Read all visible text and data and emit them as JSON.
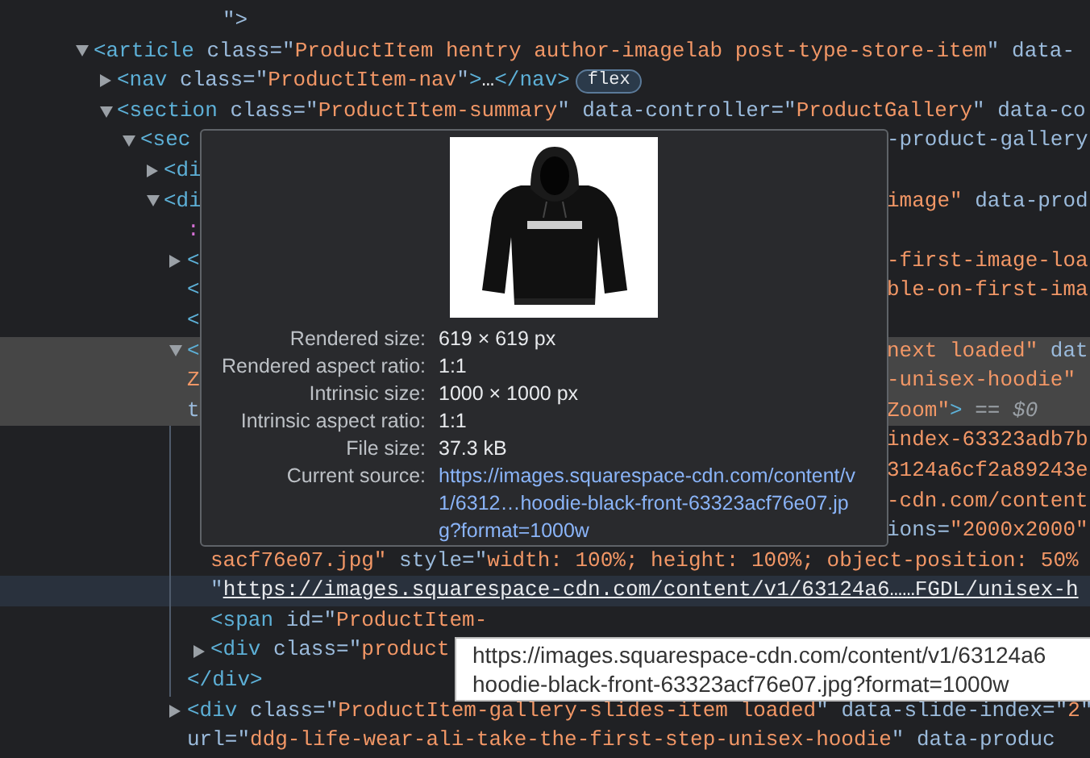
{
  "elements_tree": [
    {
      "kind": "tail",
      "selected": false,
      "left": [
        {
          "kind": "attr",
          "text": "\">"
        }
      ]
    },
    {
      "kind": "branch",
      "expanded": true,
      "selected": false,
      "left": [
        {
          "kind": "tag",
          "text": "<article"
        },
        {
          "kind": "attr",
          "text": " class=\""
        },
        {
          "kind": "val",
          "text": "ProductItem hentry author-imagelab post-type-store-item"
        },
        {
          "kind": "attr",
          "text": "\" data-"
        }
      ],
      "children": [
        {
          "kind": "branch",
          "expanded": false,
          "selected": false,
          "left": [
            {
              "kind": "tag",
              "text": "<nav"
            },
            {
              "kind": "attr",
              "text": " class=\""
            },
            {
              "kind": "val",
              "text": "ProductItem-nav"
            },
            {
              "kind": "attr",
              "text": "\""
            },
            {
              "kind": "tag",
              "text": ">"
            },
            {
              "kind": "text",
              "text": "…"
            },
            {
              "kind": "tag",
              "text": "</nav>"
            }
          ],
          "badge": "flex"
        },
        {
          "kind": "branch",
          "expanded": true,
          "selected": false,
          "left": [
            {
              "kind": "tag",
              "text": "<section"
            },
            {
              "kind": "attr",
              "text": " class=\""
            },
            {
              "kind": "val",
              "text": "ProductItem-summary"
            },
            {
              "kind": "attr",
              "text": "\" data-controller=\""
            },
            {
              "kind": "val",
              "text": "ProductGallery"
            },
            {
              "kind": "attr",
              "text": "\" data-co"
            }
          ],
          "children": [
            {
              "kind": "branch",
              "expanded": true,
              "selected": false,
              "left": [
                {
                  "kind": "tag",
                  "text": "<sec"
                }
              ],
              "right": [
                {
                  "kind": "attr",
                  "text": "-product-gallery"
                }
              ],
              "children": [
                {
                  "kind": "branch",
                  "expanded": false,
                  "selected": false,
                  "left": [
                    {
                      "kind": "tag",
                      "text": "<di"
                    }
                  ]
                },
                {
                  "kind": "branch",
                  "expanded": true,
                  "selected": false,
                  "left": [
                    {
                      "kind": "tag",
                      "text": "<di"
                    }
                  ],
                  "right": [
                    {
                      "kind": "val",
                      "text": "image\""
                    },
                    {
                      "kind": "attr",
                      "text": " data-prod"
                    }
                  ],
                  "children": [
                    {
                      "kind": "leaf",
                      "selected": false,
                      "left": [
                        {
                          "kind": "pseudo",
                          "text": ":"
                        }
                      ]
                    },
                    {
                      "kind": "branch",
                      "expanded": false,
                      "selected": false,
                      "left": [
                        {
                          "kind": "tag",
                          "text": "<"
                        }
                      ],
                      "right": [
                        {
                          "kind": "val",
                          "text": "-first-image-loa"
                        }
                      ]
                    },
                    {
                      "kind": "leaf",
                      "selected": false,
                      "left": [
                        {
                          "kind": "tag",
                          "text": "<"
                        }
                      ],
                      "right": [
                        {
                          "kind": "val",
                          "text": "ble-on-first-ima"
                        }
                      ]
                    },
                    {
                      "kind": "leaf",
                      "selected": false,
                      "left": [
                        {
                          "kind": "tag",
                          "text": "<"
                        }
                      ]
                    },
                    {
                      "kind": "branch",
                      "expanded": true,
                      "selected": true,
                      "left": [
                        {
                          "kind": "tag",
                          "text": "<"
                        }
                      ],
                      "right": [
                        {
                          "kind": "val",
                          "text": "next loaded\""
                        },
                        {
                          "kind": "attr",
                          "text": " dat"
                        }
                      ],
                      "wraps": [
                        {
                          "left": [
                            {
                              "kind": "val",
                              "text": "Z"
                            }
                          ],
                          "right": [
                            {
                              "kind": "val",
                              "text": "-unisex-hoodie\""
                            }
                          ]
                        },
                        {
                          "left": [
                            {
                              "kind": "attr",
                              "text": "t"
                            }
                          ],
                          "right": [
                            {
                              "kind": "val",
                              "text": "Zoom\""
                            },
                            {
                              "kind": "tag",
                              "text": ">"
                            },
                            {
                              "kind": "muted",
                              "text": " == $0"
                            }
                          ]
                        }
                      ],
                      "children": [
                        {
                          "kind": "leaf",
                          "selected": false,
                          "right": [
                            {
                              "kind": "val",
                              "text": "index-63323adb7b"
                            }
                          ],
                          "wraps": [
                            {
                              "right": [
                                {
                                  "kind": "val",
                                  "text": "3124a6cf2a89243e"
                                }
                              ]
                            },
                            {
                              "right": [
                                {
                                  "kind": "val",
                                  "text": "-cdn.com/content"
                                }
                              ]
                            },
                            {
                              "right": [
                                {
                                  "kind": "attr",
                                  "text": "ions="
                                },
                                {
                                  "kind": "val",
                                  "text": "\"2000x2000\""
                                }
                              ]
                            },
                            {
                              "left": [
                                {
                                  "kind": "val",
                                  "text": "sacf76e07.jpg\""
                                },
                                {
                                  "kind": "attr",
                                  "text": " style=\""
                                },
                                {
                                  "kind": "val",
                                  "text": "width: 100%; height: 100%; object-position: 50%"
                                }
                              ]
                            },
                            {
                              "hovered": true,
                              "left": [
                                {
                                  "kind": "attr",
                                  "text": "\""
                                },
                                {
                                  "kind": "link",
                                  "text": "https://images.squarespace-cdn.com/content/v1/63124a6……FGDL/unisex-h"
                                }
                              ]
                            }
                          ]
                        },
                        {
                          "kind": "leaf",
                          "selected": false,
                          "left": [
                            {
                              "kind": "tag",
                              "text": "<span"
                            },
                            {
                              "kind": "attr",
                              "text": " id=\""
                            },
                            {
                              "kind": "val",
                              "text": "ProductItem-"
                            }
                          ]
                        },
                        {
                          "kind": "branch",
                          "expanded": false,
                          "selected": false,
                          "left": [
                            {
                              "kind": "tag",
                              "text": "<div"
                            },
                            {
                              "kind": "attr",
                              "text": " class=\""
                            },
                            {
                              "kind": "val",
                              "text": "product"
                            }
                          ]
                        }
                      ],
                      "close": [
                        {
                          "kind": "tag",
                          "text": "</div>"
                        }
                      ]
                    },
                    {
                      "kind": "branch",
                      "expanded": false,
                      "selected": false,
                      "left": [
                        {
                          "kind": "tag",
                          "text": "<div"
                        },
                        {
                          "kind": "attr",
                          "text": " class=\""
                        },
                        {
                          "kind": "val",
                          "text": "ProductItem-gallery-slides-item loaded"
                        },
                        {
                          "kind": "attr",
                          "text": "\" data-slide-index=\""
                        },
                        {
                          "kind": "val",
                          "text": "2"
                        },
                        {
                          "kind": "attr",
                          "text": "\""
                        }
                      ],
                      "wraps": [
                        {
                          "left": [
                            {
                              "kind": "attr",
                              "text": "url=\""
                            },
                            {
                              "kind": "val",
                              "text": "ddg-life-wear-ali-take-the-first-step-unisex-hoodie"
                            },
                            {
                              "kind": "attr",
                              "text": "\" data-produc"
                            }
                          ]
                        }
                      ]
                    }
                  ]
                }
              ]
            }
          ]
        }
      ]
    }
  ],
  "image_tooltip": {
    "properties": [
      {
        "kind": "text",
        "label": "Rendered size:",
        "value": "619 × 619 px"
      },
      {
        "kind": "text",
        "label": "Rendered aspect ratio:",
        "value": "1:1"
      },
      {
        "kind": "text",
        "label": "Intrinsic size:",
        "value": "1000 × 1000 px"
      },
      {
        "kind": "text",
        "label": "Intrinsic aspect ratio:",
        "value": "1:1"
      },
      {
        "kind": "text",
        "label": "File size:",
        "value": "37.3 kB"
      },
      {
        "kind": "link",
        "label": "Current source:",
        "value": "https://images.squarespace-cdn.com/content/v1/6312…hoodie-black-front-63323acf76e07.jpg?format=1000w"
      }
    ]
  },
  "url_tooltip": {
    "lines": [
      "https://images.squarespace-cdn.com/content/v1/63124a6",
      "hoodie-black-front-63323acf76e07.jpg?format=1000w"
    ]
  }
}
